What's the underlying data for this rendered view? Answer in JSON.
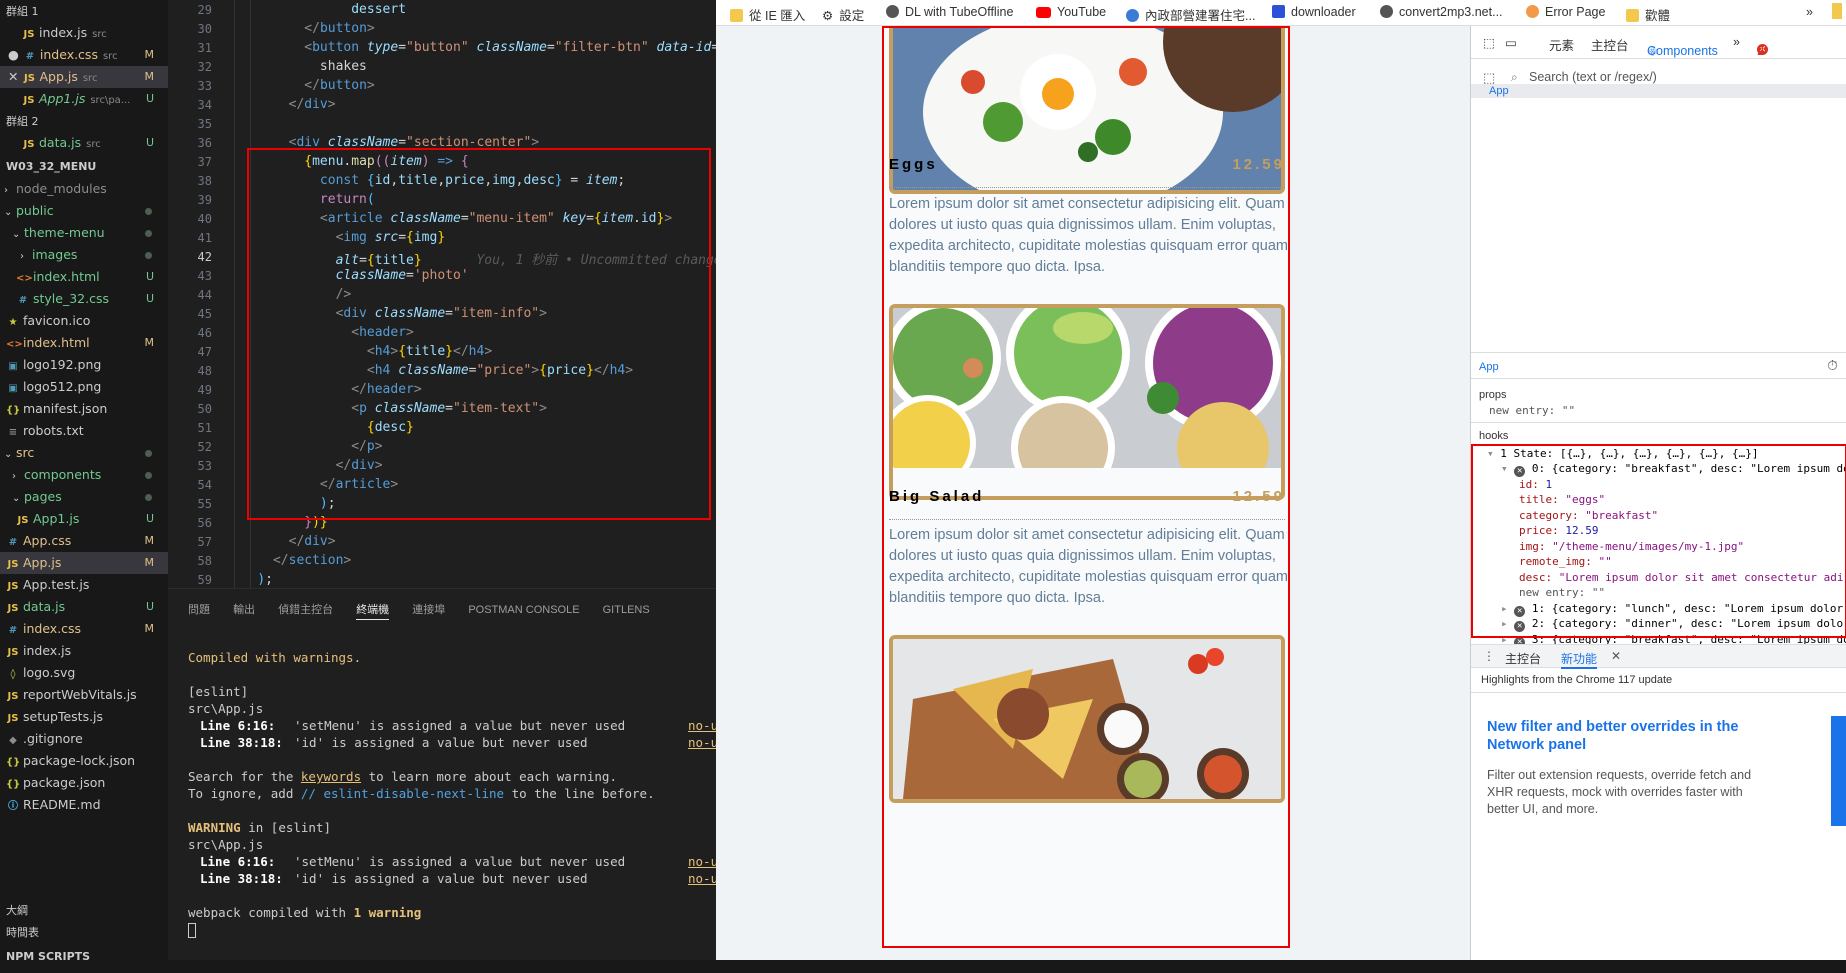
{
  "explorer": {
    "group1": "群組 1",
    "group2": "群組 2",
    "project": "W03_32_MENU",
    "items": [
      {
        "label": "index.js",
        "path": "src",
        "badge": ""
      },
      {
        "label": "index.css",
        "path": "src",
        "badge": "M"
      },
      {
        "label": "App.js",
        "path": "src",
        "badge": "M"
      },
      {
        "label": "App1.js",
        "path": "src\\pa...",
        "badge": "U"
      },
      {
        "label": "data.js",
        "path": "src",
        "badge": "U"
      },
      {
        "label": "node_modules",
        "badge": ""
      },
      {
        "label": "public",
        "badge": ""
      },
      {
        "label": "theme-menu",
        "badge": ""
      },
      {
        "label": "images",
        "badge": ""
      },
      {
        "label": "index.html",
        "badge": "U"
      },
      {
        "label": "style_32.css",
        "badge": "U"
      },
      {
        "label": "favicon.ico",
        "badge": ""
      },
      {
        "label": "index.html",
        "badge": "M"
      },
      {
        "label": "logo192.png",
        "badge": ""
      },
      {
        "label": "logo512.png",
        "badge": ""
      },
      {
        "label": "manifest.json",
        "badge": ""
      },
      {
        "label": "robots.txt",
        "badge": ""
      },
      {
        "label": "src",
        "badge": ""
      },
      {
        "label": "components",
        "badge": ""
      },
      {
        "label": "pages",
        "badge": ""
      },
      {
        "label": "App1.js",
        "badge": "U"
      },
      {
        "label": "App.css",
        "badge": "M"
      },
      {
        "label": "App.js",
        "badge": "M"
      },
      {
        "label": "App.test.js",
        "badge": ""
      },
      {
        "label": "data.js",
        "badge": "U"
      },
      {
        "label": "index.css",
        "badge": "M"
      },
      {
        "label": "index.js",
        "badge": ""
      },
      {
        "label": "logo.svg",
        "badge": ""
      },
      {
        "label": "reportWebVitals.js",
        "badge": ""
      },
      {
        "label": "setupTests.js",
        "badge": ""
      },
      {
        "label": ".gitignore",
        "badge": ""
      },
      {
        "label": "package-lock.json",
        "badge": ""
      },
      {
        "label": "package.json",
        "badge": ""
      },
      {
        "label": "README.md",
        "badge": ""
      }
    ],
    "outline": "大綱",
    "timeline": "時間表",
    "npm": "NPM SCRIPTS"
  },
  "editor": {
    "line_numbers": [
      "29",
      "30",
      "31",
      "32",
      "33",
      "34",
      "35",
      "36",
      "37",
      "38",
      "39",
      "40",
      "41",
      "42",
      "43",
      "44",
      "45",
      "46",
      "47",
      "48",
      "49",
      "50",
      "51",
      "52",
      "53",
      "54",
      "55",
      "56",
      "57",
      "58",
      "59"
    ],
    "blame": "You, 1 秒前 • Uncommitted changes"
  },
  "panel": {
    "tabs": [
      "問題",
      "輸出",
      "偵錯主控台",
      "終端機",
      "連接埠",
      "POSTMAN CONSOLE",
      "GITLENS"
    ],
    "compiled": "Compiled with warnings.",
    "eslint": "[eslint]",
    "file": "src\\App.js",
    "w1_loc": "Line 6:16:",
    "w1_msg": "'setMenu' is assigned a value but never used",
    "w1_rule": "no-unused-vars",
    "w2_loc": "Line 38:18:",
    "w2_msg": "'id' is assigned a value but never used",
    "w2_rule": "no-unused-vars",
    "search_pre": "Search for the ",
    "search_link": "keywords",
    "search_post": " to learn more about each warning.",
    "ignore_pre": "To ignore, add ",
    "ignore_code": "// eslint-disable-next-line",
    "ignore_post": " to the line before.",
    "warning_label": "WARNING",
    "warning_in": " in [eslint]",
    "webpack_pre": "webpack compiled with ",
    "webpack_num": "1 warning"
  },
  "bookmarks": [
    "從 IE 匯入",
    "設定",
    "DL with TubeOffline",
    "YouTube",
    "內政部營建署住宅...",
    "downloader",
    "convert2mp3.net...",
    "Error Page",
    "歡體",
    "»"
  ],
  "menu": {
    "items": [
      {
        "title": "Eggs",
        "price": "12.59",
        "desc": "Lorem ipsum dolor sit amet consectetur adipisicing elit. Quam dolores ut iusto quas quia dignissimos ullam. Enim voluptas, expedita architecto, cupiditate molestias quisquam error quam blanditiis tempore quo dicta. Ipsa."
      },
      {
        "title": "Big Salad",
        "price": "12.59",
        "desc": "Lorem ipsum dolor sit amet consectetur adipisicing elit. Quam dolores ut iusto quas quia dignissimos ullam. Enim voluptas, expedita architecto, cupiditate molestias quisquam error quam blanditiis tempore quo dicta. Ipsa."
      }
    ]
  },
  "devtools": {
    "tabs": [
      "元素",
      "主控台",
      "Components",
      "»"
    ],
    "error_count": "2",
    "search_placeholder": "Search (text or /regex/)",
    "tree_root": "App",
    "selected": "App",
    "props_label": "props",
    "props_entry": "new entry: \"\"",
    "hooks_label": "hooks",
    "state": "1 State: [{…}, {…}, {…}, {…}, {…}, {…}]",
    "s0": "0: {category: \"breakfast\", desc: \"Lorem ipsum do",
    "id_k": "id:",
    "id_v": "1",
    "title_k": "title:",
    "title_v": "\"eggs\"",
    "cat_k": "category:",
    "cat_v": "\"breakfast\"",
    "price_k": "price:",
    "price_v": "12.59",
    "img_k": "img:",
    "img_v": "\"/theme-menu/images/my-1.jpg\"",
    "remote_k": "remote_img:",
    "remote_v": "\"\"",
    "desc_k": "desc:",
    "desc_v": "\"Lorem ipsum dolor sit amet consectetur adi",
    "new_entry": "new entry: \"\"",
    "s1": "1: {category: \"lunch\", desc: \"Lorem ipsum dolor",
    "s2": "2: {category: \"dinner\", desc: \"Lorem ipsum dolor",
    "s3": "3: {category: \"breakfast\", desc: \"Lorem ipsum do",
    "drawer_tabs": [
      "主控台",
      "新功能"
    ],
    "highlights": "Highlights from the Chrome 117 update",
    "news_title": "New filter and better overrides in the Network panel",
    "news_body": "Filter out extension requests, override fetch and XHR requests, mock with overrides faster with better UI, and more."
  }
}
